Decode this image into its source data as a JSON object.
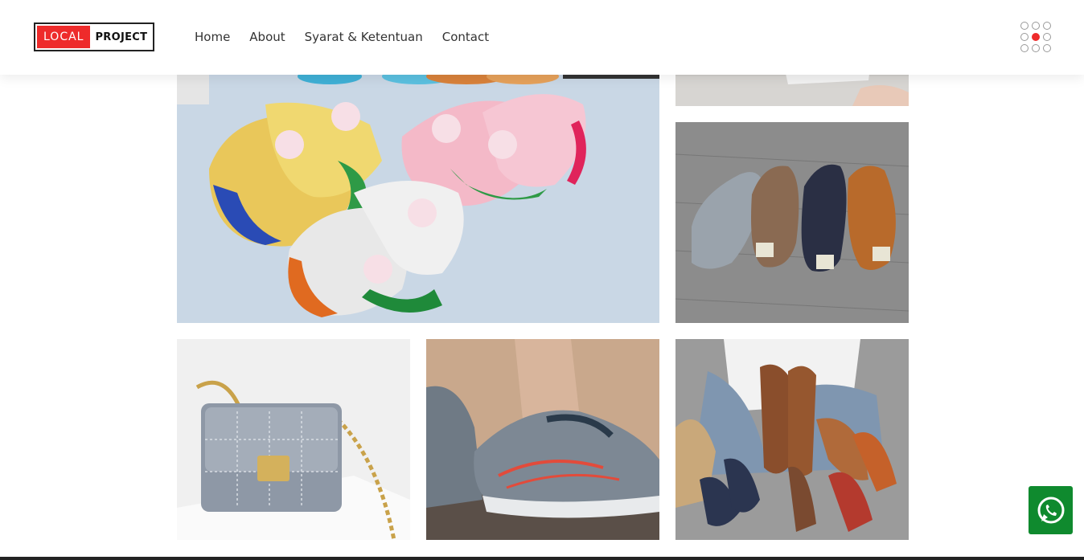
{
  "brand": {
    "part1": "LOCAL",
    "part2": "PROJECT"
  },
  "nav": [
    {
      "label": "Home"
    },
    {
      "label": "About"
    },
    {
      "label": "Syarat & Ketentuan"
    },
    {
      "label": "Contact"
    }
  ],
  "menu_icon": "grid-menu-icon",
  "gallery": [
    {
      "name": "kids-slides-photo"
    },
    {
      "name": "top-cropped-photo"
    },
    {
      "name": "flip-flops-photo"
    },
    {
      "name": "handbag-photo"
    },
    {
      "name": "running-shoe-photo"
    },
    {
      "name": "sandals-photo"
    }
  ],
  "whatsapp_icon": "whatsapp-icon",
  "colors": {
    "accent": "#ee2b2b",
    "whatsapp": "#0f8a2e",
    "text": "#333333"
  }
}
